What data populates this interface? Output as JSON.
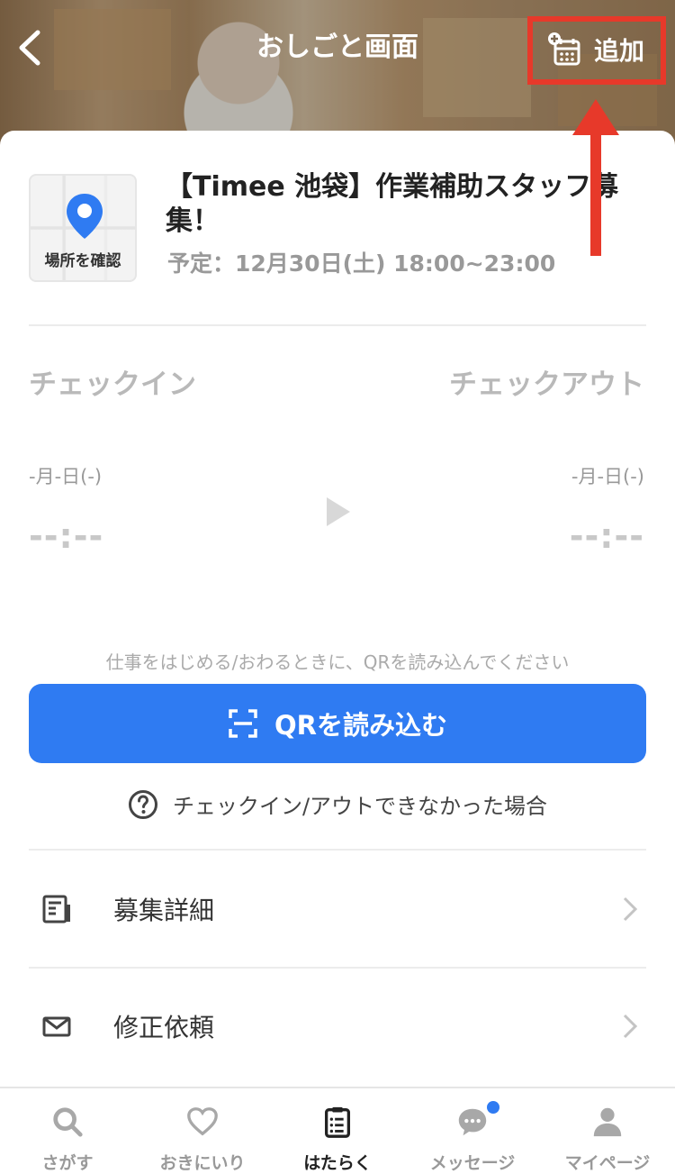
{
  "header": {
    "title": "おしごと画面",
    "add_label": "追加"
  },
  "job": {
    "map_label": "場所を確認",
    "title": "【Timee 池袋】作業補助スタッフ募集！",
    "schedule": "予定：12月30日(土) 18:00~23:00"
  },
  "checkin": {
    "label": "チェックイン",
    "date": "-月-日(-)",
    "time": "--:--"
  },
  "checkout": {
    "label": "チェックアウト",
    "date": "-月-日(-)",
    "time": "--:--"
  },
  "qr": {
    "hint": "仕事をはじめる/おわるときに、QRを読み込んでください",
    "button_label": "QRを読み込む"
  },
  "help": {
    "label": "チェックイン/アウトできなかった場合"
  },
  "menu": [
    {
      "label": "募集詳細",
      "icon": "document-icon"
    },
    {
      "label": "修正依頼",
      "icon": "mail-icon"
    }
  ],
  "nav": [
    {
      "label": "さがす",
      "icon": "search-icon"
    },
    {
      "label": "おきにいり",
      "icon": "heart-icon"
    },
    {
      "label": "はたらく",
      "icon": "clipboard-icon",
      "active": true
    },
    {
      "label": "メッセージ",
      "icon": "chat-icon",
      "badge": true
    },
    {
      "label": "マイページ",
      "icon": "person-icon"
    }
  ],
  "colors": {
    "primary": "#2f7bf2",
    "annotation": "#e7392a"
  }
}
